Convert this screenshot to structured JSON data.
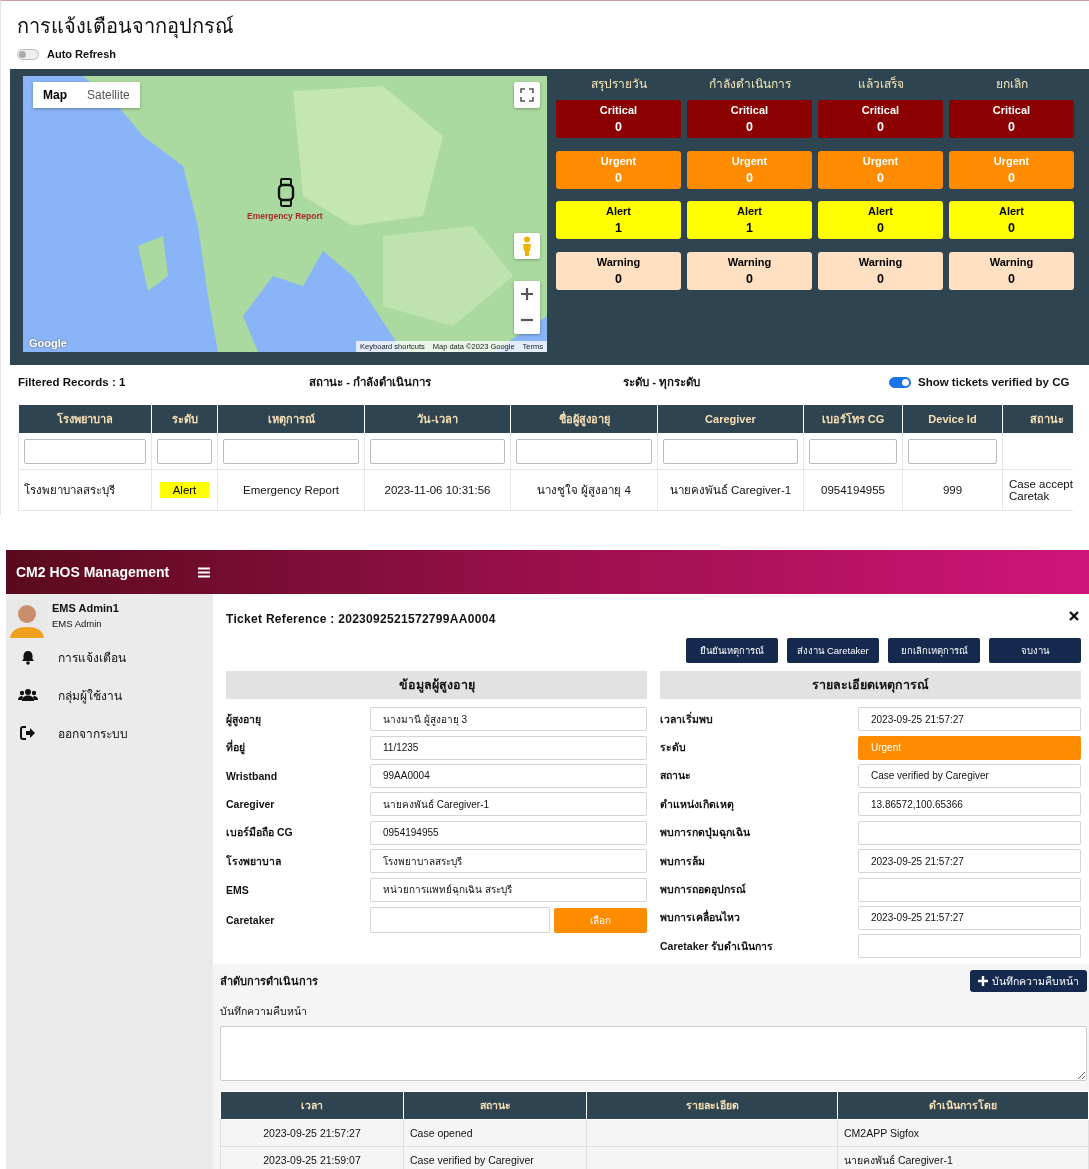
{
  "alerts_page": {
    "title": "การแจ้งเตือนจากอุปกรณ์",
    "auto_refresh": {
      "label": "Auto Refresh",
      "on": false
    },
    "map": {
      "map_types": [
        {
          "label": "Map",
          "selected": true
        },
        {
          "label": "Satellite",
          "selected": false
        }
      ],
      "marker_label": "Emergency Report",
      "logo": "Google",
      "attribution": [
        "Keyboard shortcuts",
        "Map data ©2023 Google",
        "Terms"
      ]
    },
    "summary": [
      {
        "title": "สรุปรายวัน",
        "tiles": [
          {
            "kind": "critical",
            "label": "Critical",
            "count": "0"
          },
          {
            "kind": "urgent",
            "label": "Urgent",
            "count": "0"
          },
          {
            "kind": "alert",
            "label": "Alert",
            "count": "1"
          },
          {
            "kind": "warning",
            "label": "Warning",
            "count": "0"
          }
        ]
      },
      {
        "title": "กำลังดำเนินการ",
        "tiles": [
          {
            "kind": "critical",
            "label": "Critical",
            "count": "0"
          },
          {
            "kind": "urgent",
            "label": "Urgent",
            "count": "0"
          },
          {
            "kind": "alert",
            "label": "Alert",
            "count": "1"
          },
          {
            "kind": "warning",
            "label": "Warning",
            "count": "0"
          }
        ]
      },
      {
        "title": "แล้วเสร็จ",
        "tiles": [
          {
            "kind": "critical",
            "label": "Critical",
            "count": "0"
          },
          {
            "kind": "urgent",
            "label": "Urgent",
            "count": "0"
          },
          {
            "kind": "alert",
            "label": "Alert",
            "count": "0"
          },
          {
            "kind": "warning",
            "label": "Warning",
            "count": "0"
          }
        ]
      },
      {
        "title": "ยกเลิก",
        "tiles": [
          {
            "kind": "critical",
            "label": "Critical",
            "count": "0"
          },
          {
            "kind": "urgent",
            "label": "Urgent",
            "count": "0"
          },
          {
            "kind": "alert",
            "label": "Alert",
            "count": "0"
          },
          {
            "kind": "warning",
            "label": "Warning",
            "count": "0"
          }
        ]
      }
    ],
    "filters": {
      "records": "Filtered Records : 1",
      "status": "สถานะ - กำลังดำเนินการ",
      "severity": "ระดับ - ทุกระดับ",
      "verified_toggle": {
        "label": "Show tickets verified by CG",
        "on": true
      }
    },
    "table": {
      "columns": [
        {
          "label": "โรงพยาบาล",
          "filterable": true
        },
        {
          "label": "ระดับ",
          "filterable": true
        },
        {
          "label": "เหตุการณ์",
          "filterable": true
        },
        {
          "label": "วัน-เวลา",
          "filterable": true
        },
        {
          "label": "ชื่อผู้สูงอายุ",
          "filterable": true
        },
        {
          "label": "Caregiver",
          "filterable": true
        },
        {
          "label": "เบอร์โทร CG",
          "filterable": true
        },
        {
          "label": "Device Id",
          "filterable": true
        },
        {
          "label": "สถานะ",
          "filterable": false
        }
      ],
      "rows": [
        {
          "cells": [
            {
              "kind": "text",
              "text": "โรงพยาบาลสระบุรี"
            },
            {
              "kind": "alert",
              "text": "Alert"
            },
            {
              "kind": "text",
              "text": "Emergency Report"
            },
            {
              "kind": "text",
              "text": "2023-11-06 10:31:56"
            },
            {
              "kind": "text",
              "text": "นางชูใจ ผู้สูงอายุ 4"
            },
            {
              "kind": "text",
              "text": "นายคงพันธ์ Caregiver-1"
            },
            {
              "kind": "text",
              "text": "0954194955"
            },
            {
              "kind": "text",
              "text": "999"
            },
            {
              "kind": "text",
              "text": "Case accept\nCaretak"
            }
          ]
        }
      ]
    }
  },
  "management": {
    "app_title": "CM2 HOS Management",
    "user": {
      "name": "EMS Admin1",
      "role": "EMS Admin"
    },
    "nav": [
      {
        "kind": "bell",
        "label": "การแจ้งเตือน"
      },
      {
        "kind": "users",
        "label": "กลุ่มผู้ใช้งาน"
      },
      {
        "kind": "logout",
        "label": "ออกจากระบบ"
      }
    ],
    "ticket": {
      "reference": "Ticket Reference : 2023092521572799AA0004",
      "actions": [
        "ยืนยันเหตุการณ์",
        "ส่งงาน Caretaker",
        "ยกเลิกเหตุการณ์",
        "จบงาน"
      ],
      "elder": {
        "heading": "ข้อมูลผู้สูงอายุ",
        "fields": [
          {
            "label": "ผู้สูงอายุ",
            "value": "นางมานี ผู้สูงอายุ 3"
          },
          {
            "label": "ที่อยู่",
            "value": "11/1235"
          },
          {
            "label": "Wristband",
            "value": "99AA0004"
          },
          {
            "label": "Caregiver",
            "value": "นายคงพันธ์ Caregiver-1"
          },
          {
            "label": "เบอร์มือถือ CG",
            "value": "0954194955"
          },
          {
            "label": "โรงพยาบาล",
            "value": "โรงพยาบาลสระบุรี"
          },
          {
            "label": "EMS",
            "value": "หน่วยการแพทย์ฉุกเฉิน สระบุรี"
          }
        ],
        "caretaker": {
          "label": "Caretaker",
          "button": "เลือก"
        }
      },
      "event": {
        "heading": "รายละเอียดเหตุการณ์",
        "fields": [
          {
            "kind": "text",
            "label": "เวลาเริ่มพบ",
            "value": "2023-09-25 21:57:27"
          },
          {
            "kind": "urgent",
            "label": "ระดับ",
            "value": "Urgent"
          },
          {
            "kind": "text",
            "label": "สถานะ",
            "value": "Case verified by Caregiver"
          },
          {
            "kind": "text",
            "label": "ตำแหน่งเกิดเหตุ",
            "value": "13.86572,100.65366"
          },
          {
            "kind": "text",
            "label": "พบการกดปุ่มฉุกเฉิน"
          },
          {
            "kind": "text",
            "label": "พบการล้ม",
            "value": "2023-09-25 21:57:27"
          },
          {
            "kind": "text",
            "label": "พบการถอดอุปกรณ์"
          },
          {
            "kind": "text",
            "label": "พบการเคลื่อนไหว",
            "value": "2023-09-25 21:57:27"
          },
          {
            "kind": "text",
            "label": "Caretaker รับดำเนินการ"
          }
        ]
      }
    },
    "progress": {
      "heading": "ลำดับการดำเนินการ",
      "add_button": "บันทึกความคืบหน้า",
      "note_label": "บันทึกความคืบหน้า",
      "columns": [
        "เวลา",
        "สถานะ",
        "รายละเอียด",
        "ดำเนินการโดย"
      ],
      "rows": [
        [
          "2023-09-25 21:57:27",
          "Case opened",
          "",
          "CM2APP Sigfox"
        ],
        [
          "2023-09-25 21:59:07",
          "Case verified by Caregiver",
          "",
          "นายคงพันธ์ Caregiver-1"
        ]
      ]
    }
  }
}
